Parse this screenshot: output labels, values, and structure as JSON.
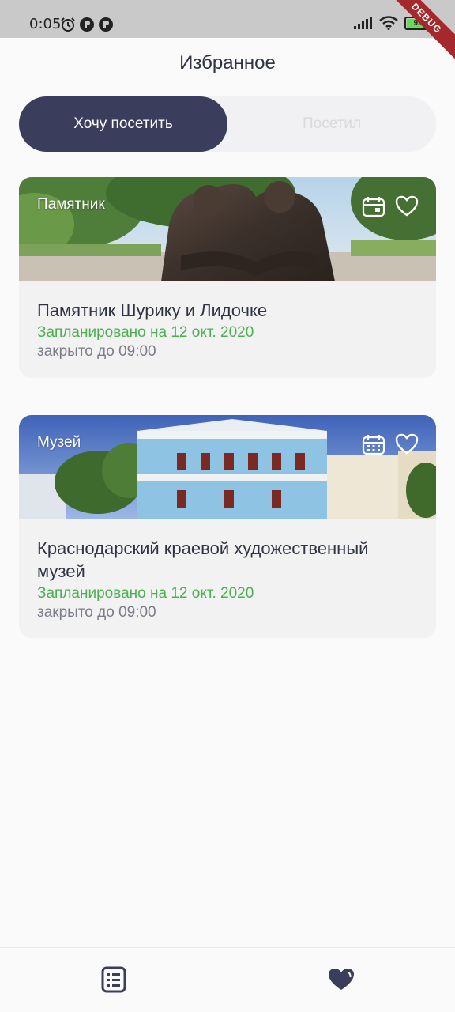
{
  "status_bar": {
    "time": "0:05",
    "battery_level": "99"
  },
  "debug_banner": "DEBUG",
  "header": {
    "title": "Избранное"
  },
  "tabs": [
    {
      "label": "Хочу посетить",
      "active": true
    },
    {
      "label": "Посетил",
      "active": false
    }
  ],
  "cards": [
    {
      "category": "Памятник",
      "title": "Памятник Шурику и Лидочке",
      "planned": "Запланировано на 12 окт. 2020",
      "hours": "закрыто до 09:00"
    },
    {
      "category": "Музей",
      "title": "Краснодарский краевой художественный музей",
      "planned": "Запланировано на 12 окт. 2020",
      "hours": "закрыто до 09:00"
    }
  ],
  "bottom_nav": [
    {
      "icon": "list-icon",
      "active": false
    },
    {
      "icon": "heart-icon",
      "active": true
    }
  ],
  "colors": {
    "accent_dark": "#3a3d5c",
    "planned_green": "#4caf50",
    "muted_text": "#7a7c88"
  }
}
